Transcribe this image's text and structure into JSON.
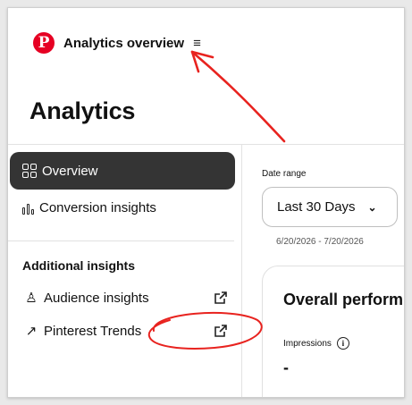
{
  "header": {
    "app_title": "Analytics overview",
    "menu_icon": "hamburger-menu-icon",
    "logo_icon": "pinterest-logo"
  },
  "page": {
    "title": "Analytics"
  },
  "sidebar": {
    "nav": [
      {
        "label": "Overview",
        "icon": "grid-icon",
        "active": true
      },
      {
        "label": "Conversion insights",
        "icon": "bar-chart-icon",
        "active": false
      }
    ],
    "section_title": "Additional insights",
    "links": [
      {
        "label": "Audience insights",
        "icon": "person-icon",
        "trailing_icon": "external-link-icon"
      },
      {
        "label": "Pinterest Trends",
        "icon": "trend-arrow-icon",
        "trailing_icon": "external-link-icon"
      }
    ]
  },
  "main": {
    "date_range_label": "Date range",
    "date_range_value": "Last 30 Days",
    "date_range_text": "6/20/2026 - 7/20/2026",
    "performance_title": "Overall perform",
    "metric_label": "Impressions",
    "metric_value": "-"
  },
  "colors": {
    "brand": "#e60023",
    "active_nav_bg": "#343434",
    "annotation": "#e8231f"
  }
}
